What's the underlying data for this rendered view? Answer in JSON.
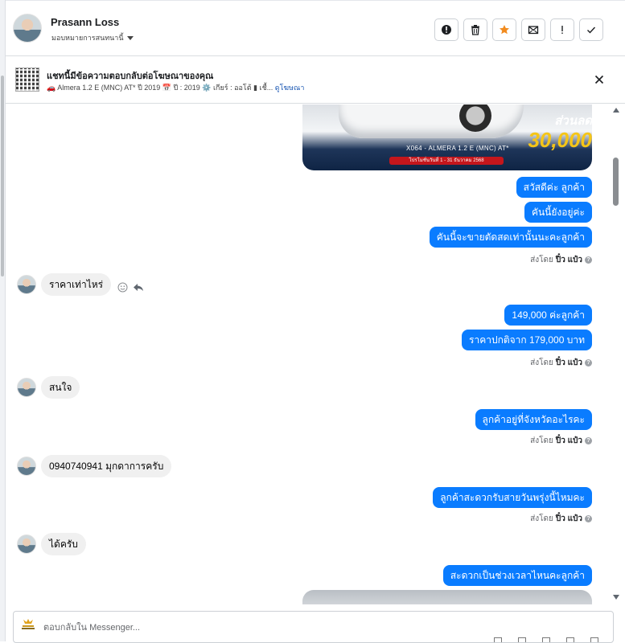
{
  "header": {
    "contact_name": "Prasann Loss",
    "assign_label": "มอบหมายการสนทนานี้",
    "actions": [
      {
        "name": "mark-spam",
        "icon": "alert-circle-icon"
      },
      {
        "name": "delete",
        "icon": "trash-icon"
      },
      {
        "name": "star",
        "icon": "star-icon"
      },
      {
        "name": "mark-unread",
        "icon": "envelope-icon"
      },
      {
        "name": "follow-up",
        "icon": "exclamation-icon"
      },
      {
        "name": "mark-done",
        "icon": "check-icon"
      }
    ]
  },
  "ad_banner": {
    "title": "แชทนี้มีข้อความตอบกลับต่อโฆษณาของคุณ",
    "description": "🚗 Almera 1.2 E (MNC) AT* ปี 2019 📅 ปี : 2019 ⚙️ เกียร์ : ออโต้ ▮ เชื้...",
    "link": "ดูโฆษณา"
  },
  "car_image": {
    "discount_label": "ส่วนลด",
    "discount_amount": "30,000",
    "caption": "X064 - ALMERA 1.2 E (MNC) AT*",
    "promo": "โปรโมชั่นวันที่ 1 - 31 ธันวาคม 2568"
  },
  "messages": {
    "out1": "สวัสดีค่ะ  ลูกค้า",
    "out2": "คันนี้ยังอยู่ค่ะ",
    "out3": "คันนี้จะขายตัดสดเท่านั้นนะคะลูกค้า",
    "in1": "ราคาเท่าไหร่",
    "out4": "149,000  ค่ะลูกค้า",
    "out5": "ราคาปกติจาก 179,000 บาท",
    "in2": "สนใจ",
    "out6": "ลูกค้าอยู่ที่จังหวัดอะไรคะ",
    "in3": "0940740941 มุกดาการครับ",
    "out7": "ลูกค้าสะดวกรับสายวันพรุ่งนี้ไหมคะ",
    "in4": "ได้ครับ",
    "out8": "สะดวกเป็นช่วงเวลาไหนคะลูกค้า"
  },
  "sent_by": {
    "prefix": "ส่งโดย",
    "agent": "ปิ๋ว แป๋ว",
    "help_mark": "?"
  },
  "composer": {
    "placeholder": "ตอบกลับใน Messenger..."
  },
  "colors": {
    "outgoing_bubble": "#0a7cff",
    "incoming_bubble": "#f0f0f0",
    "star": "#f28b1e"
  }
}
